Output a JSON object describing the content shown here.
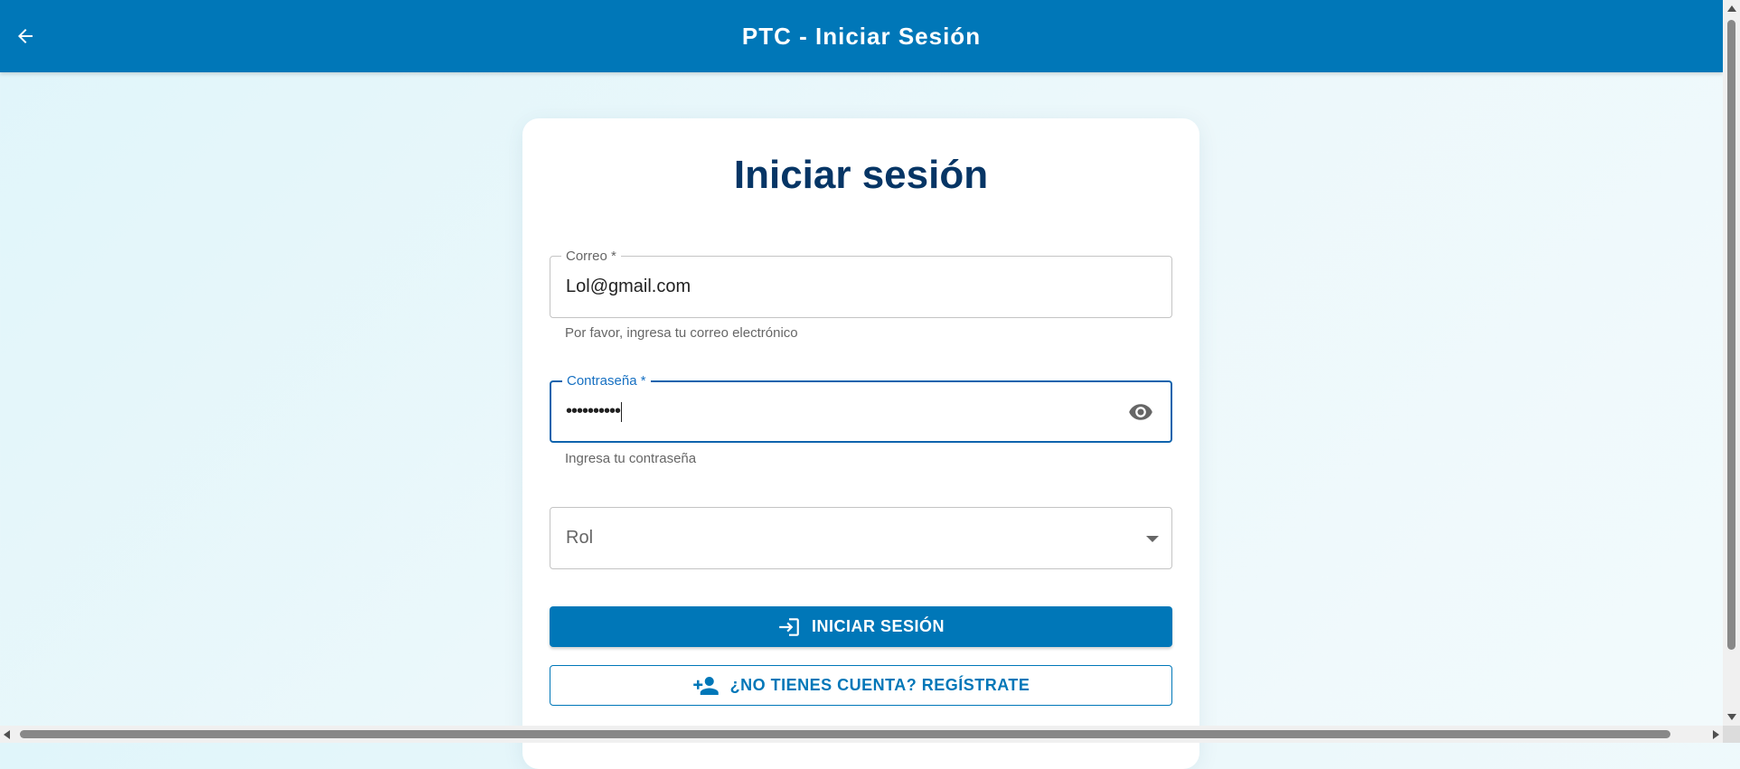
{
  "appbar": {
    "title": "PTC - Iniciar Sesión",
    "back_icon": "arrow-left-icon",
    "color": "#0077b8"
  },
  "card": {
    "title": "Iniciar sesión",
    "email": {
      "label": "Correo *",
      "value": "Lol@gmail.com",
      "helper": "Por favor, ingresa tu correo electrónico"
    },
    "password": {
      "label": "Contraseña *",
      "value": "••••••••••",
      "helper": "Ingresa tu contraseña",
      "toggle_icon": "eye-icon"
    },
    "role": {
      "placeholder": "Rol",
      "icon": "dropdown-arrow-icon"
    },
    "login_button": {
      "label": "INICIAR SESIÓN",
      "icon": "login-icon"
    },
    "register_button": {
      "label": "¿NO TIENES CUENTA? REGÍSTRATE",
      "icon": "person-add-icon"
    }
  },
  "colors": {
    "primary": "#0077b8",
    "title": "#063565",
    "focus": "#0f63ad"
  }
}
